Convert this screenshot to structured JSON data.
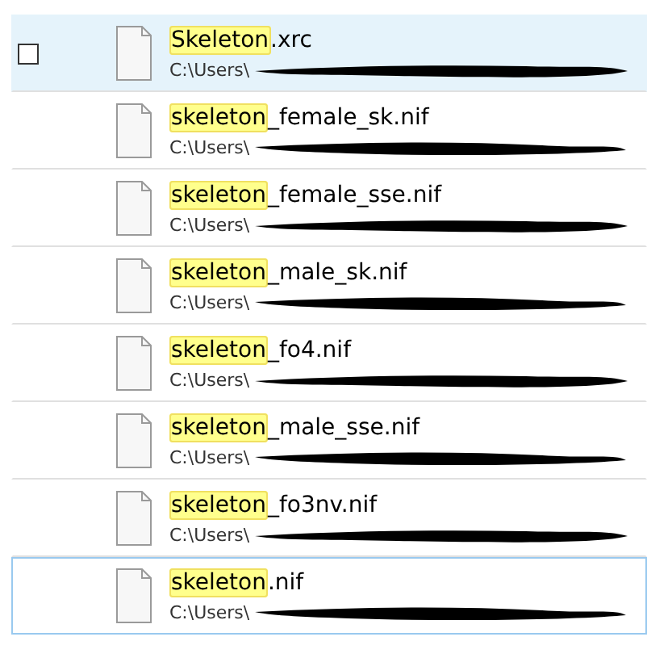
{
  "results": [
    {
      "match": "Skeleton",
      "rest": ".xrc",
      "path": "C:\\Users\\",
      "hovered": true,
      "focused": false,
      "checkbox": {
        "checked": false
      }
    },
    {
      "match": "skeleton",
      "rest": "_female_sk.nif",
      "path": "C:\\Users\\",
      "hovered": false,
      "focused": false
    },
    {
      "match": "skeleton",
      "rest": "_female_sse.nif",
      "path": "C:\\Users\\",
      "hovered": false,
      "focused": false
    },
    {
      "match": "skeleton",
      "rest": "_male_sk.nif",
      "path": "C:\\Users\\",
      "hovered": false,
      "focused": false
    },
    {
      "match": "skeleton",
      "rest": "_fo4.nif",
      "path": "C:\\Users\\",
      "hovered": false,
      "focused": false
    },
    {
      "match": "skeleton",
      "rest": "_male_sse.nif",
      "path": "C:\\Users\\",
      "hovered": false,
      "focused": false
    },
    {
      "match": "skeleton",
      "rest": "_fo3nv.nif",
      "path": "C:\\Users\\",
      "hovered": false,
      "focused": false
    },
    {
      "match": "skeleton",
      "rest": ".nif",
      "path": "C:\\Users\\",
      "hovered": false,
      "focused": true
    }
  ]
}
